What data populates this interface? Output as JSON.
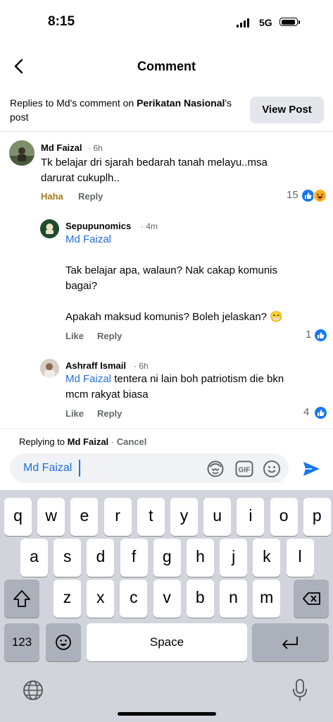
{
  "status_bar": {
    "time": "8:15",
    "network": "5G"
  },
  "header": {
    "title": "Comment"
  },
  "banner": {
    "prefix": "Replies to Md's comment on ",
    "page_name": "Perikatan Nasional",
    "suffix": "'s post",
    "view_post_label": "View Post"
  },
  "comments": [
    {
      "author": "Md Faizal",
      "time": "6h",
      "lines": [
        "Tk belajar dri sjarah bedarah tanah melayu..msa",
        "darurat cukuplh.."
      ],
      "actions": [
        "Haha",
        "Reply"
      ],
      "reaction_count": "15"
    },
    {
      "author": "Sepupunomics",
      "time": "4m",
      "mention": "Md Faizal",
      "lines": [
        "Tak belajar apa, walaun? Nak cakap komunis",
        "bagai?",
        "Apakah maksud komunis? Boleh jelaskan? 😁"
      ],
      "actions": [
        "Like",
        "Reply"
      ],
      "reaction_count": "1"
    },
    {
      "author": "Ashraff Ismail",
      "time": "6h",
      "mention": "Md Faizal",
      "lines": [
        " tentera ni lain boh patriotism die bkn",
        "mcm rakyat biasa"
      ],
      "actions": [
        "Like",
        "Reply"
      ],
      "reaction_count": "4"
    }
  ],
  "replying": {
    "prefix": "Replying to ",
    "name": "Md Faizal",
    "separator": " · ",
    "cancel": "Cancel"
  },
  "composer": {
    "value": "Md Faizal"
  },
  "keyboard": {
    "row1": [
      "q",
      "w",
      "e",
      "r",
      "t",
      "y",
      "u",
      "i",
      "o",
      "p"
    ],
    "row2": [
      "a",
      "s",
      "d",
      "f",
      "g",
      "h",
      "j",
      "k",
      "l"
    ],
    "row3": [
      "z",
      "x",
      "c",
      "v",
      "b",
      "n",
      "m"
    ],
    "numbers_label": "123",
    "space_label": "Space"
  },
  "colors": {
    "accent": "#1877f2",
    "mention": "#216fdb",
    "haha": "#a8791a"
  }
}
